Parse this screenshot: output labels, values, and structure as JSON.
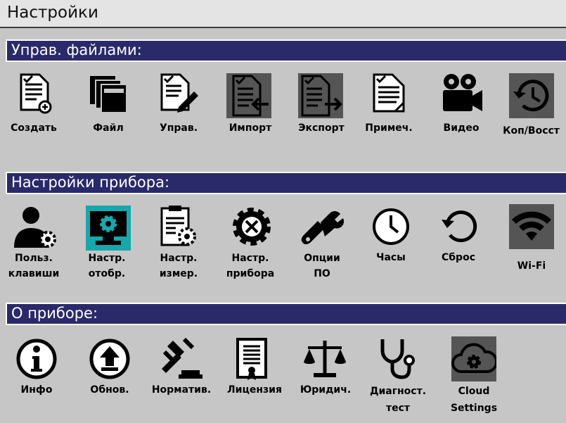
{
  "window": {
    "title": "Настройки"
  },
  "sections": [
    {
      "label": "Управ. файлами:",
      "items": [
        {
          "line1": "Создать",
          "line2": "",
          "icon": "file-create-icon"
        },
        {
          "line1": "Файл",
          "line2": "",
          "icon": "file-stack-icon"
        },
        {
          "line1": "Управ.",
          "line2": "",
          "icon": "file-edit-icon"
        },
        {
          "line1": "Импорт",
          "line2": "",
          "icon": "import-icon"
        },
        {
          "line1": "Экспорт",
          "line2": "",
          "icon": "export-icon"
        },
        {
          "line1": "Примеч.",
          "line2": "",
          "icon": "notes-icon"
        },
        {
          "line1": "Видео",
          "line2": "",
          "icon": "video-camera-icon"
        },
        {
          "line1": "Коп/Восст",
          "line2": "",
          "icon": "backup-restore-icon"
        }
      ]
    },
    {
      "label": "Настройки прибора:",
      "items": [
        {
          "line1": "Польз.",
          "line2": "клавиши",
          "icon": "user-gear-icon"
        },
        {
          "line1": "Настр.",
          "line2": "отобр.",
          "icon": "display-settings-icon"
        },
        {
          "line1": "Настр.",
          "line2": "измер.",
          "icon": "measure-settings-icon"
        },
        {
          "line1": "Настр.",
          "line2": "прибора",
          "icon": "tools-gear-icon"
        },
        {
          "line1": "Опции",
          "line2": "ПО",
          "icon": "software-options-icon"
        },
        {
          "line1": "Часы",
          "line2": "",
          "icon": "clock-icon"
        },
        {
          "line1": "Сброс",
          "line2": "",
          "icon": "reset-icon"
        },
        {
          "line1": "Wi-Fi",
          "line2": "",
          "icon": "wifi-icon"
        }
      ]
    },
    {
      "label": "О приборе:",
      "items": [
        {
          "line1": "Инфо",
          "line2": "",
          "icon": "info-icon"
        },
        {
          "line1": "Обнов.",
          "line2": "",
          "icon": "update-icon"
        },
        {
          "line1": "Норматив.",
          "line2": "",
          "icon": "gavel-icon"
        },
        {
          "line1": "Лицензия",
          "line2": "",
          "icon": "license-icon"
        },
        {
          "line1": "Юридич.",
          "line2": "",
          "icon": "scales-icon"
        },
        {
          "line1": "Диагност.",
          "line2": "тест",
          "icon": "stethoscope-icon"
        },
        {
          "line1": "Cloud",
          "line2": "Settings",
          "icon": "cloud-settings-icon"
        }
      ]
    }
  ]
}
